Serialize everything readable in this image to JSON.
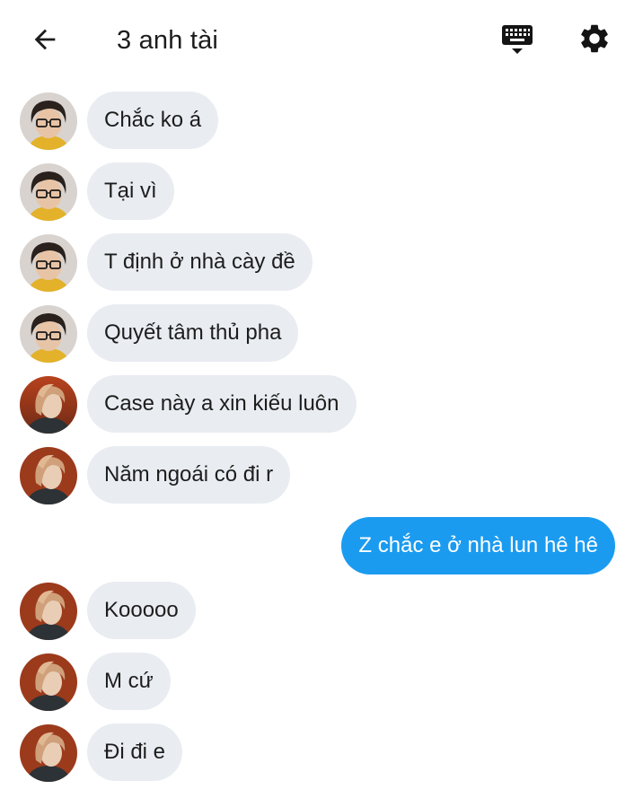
{
  "header": {
    "title": "3 anh tài",
    "back_icon": "arrow-left-icon",
    "keyboard_icon": "keyboard-icon",
    "settings_icon": "gear-icon"
  },
  "colors": {
    "incoming_bubble": "#e9ecf1",
    "outgoing_bubble": "#1b9bf0",
    "text": "#1d1d1d"
  },
  "messages": [
    {
      "sender": "glasses",
      "direction": "in",
      "text": "Chắc ko á"
    },
    {
      "sender": "glasses",
      "direction": "in",
      "text": "Tại vì"
    },
    {
      "sender": "glasses",
      "direction": "in",
      "text": "T định ở nhà cày đề"
    },
    {
      "sender": "glasses",
      "direction": "in",
      "text": "Quyết tâm thủ pha"
    },
    {
      "sender": "longhair",
      "direction": "in",
      "text": "Case này a xin kiếu luôn"
    },
    {
      "sender": "longhair",
      "direction": "in",
      "text": "Năm ngoái có đi r"
    },
    {
      "sender": "me",
      "direction": "out",
      "text": "Z chắc e ở nhà lun hê hê"
    },
    {
      "sender": "longhair",
      "direction": "in",
      "text": "Kooooo"
    },
    {
      "sender": "longhair",
      "direction": "in",
      "text": "M cứ"
    },
    {
      "sender": "longhair",
      "direction": "in",
      "text": "Đi đi e"
    }
  ]
}
